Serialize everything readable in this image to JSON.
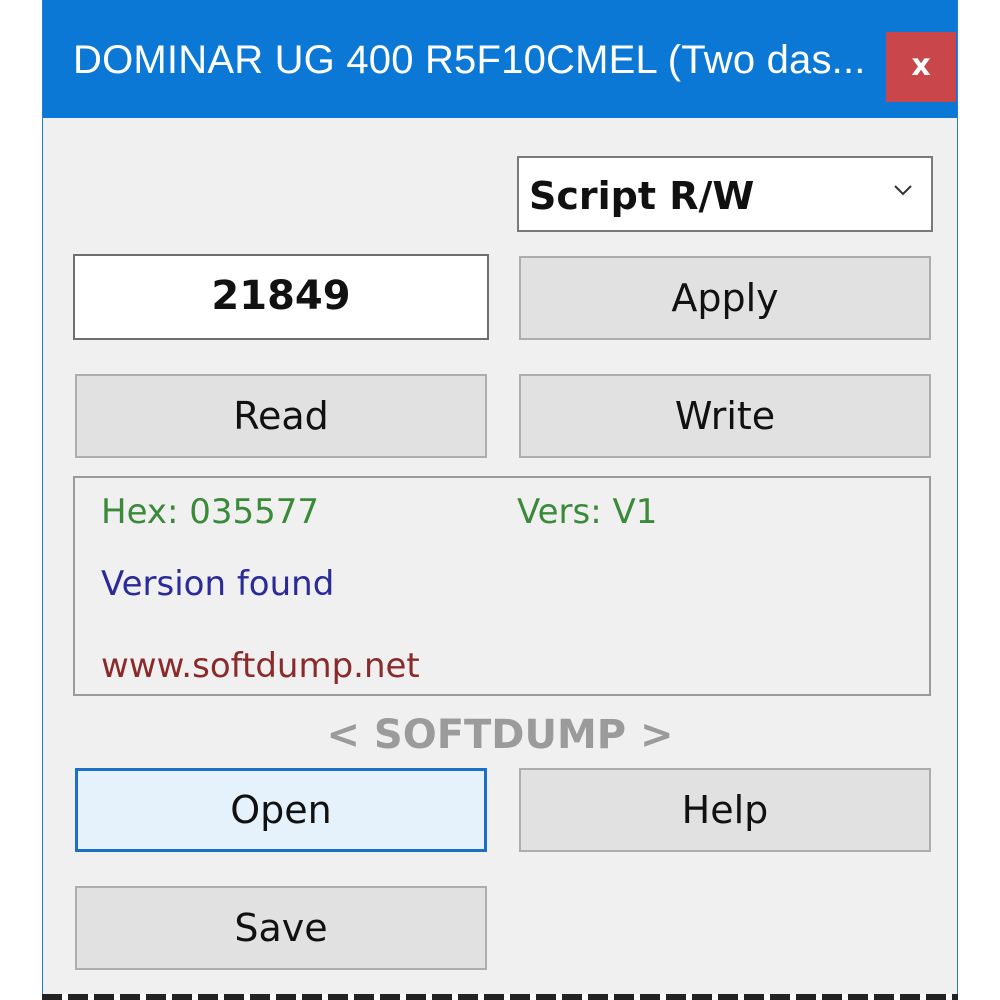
{
  "window": {
    "title": "DOMINAR UG 400 R5F10CMEL (Two das...",
    "close_label": "x",
    "accent_color": "#0c78d6",
    "close_color": "#c9474a"
  },
  "mode_select": {
    "selected": "Script R/W",
    "icon": "chevron-down-icon"
  },
  "value_field": {
    "value": "21849"
  },
  "buttons": {
    "apply": "Apply",
    "read": "Read",
    "write": "Write",
    "open": "Open",
    "help": "Help",
    "save": "Save"
  },
  "info": {
    "hex": "Hex: 035577",
    "vers": "Vers: V1",
    "status": "Version found",
    "website": "www.softdump.net",
    "hex_color": "#3a8a3a",
    "status_color": "#2a2a9a",
    "website_color": "#8a2a2a"
  },
  "brand": {
    "text": "< SOFTDUMP >"
  }
}
